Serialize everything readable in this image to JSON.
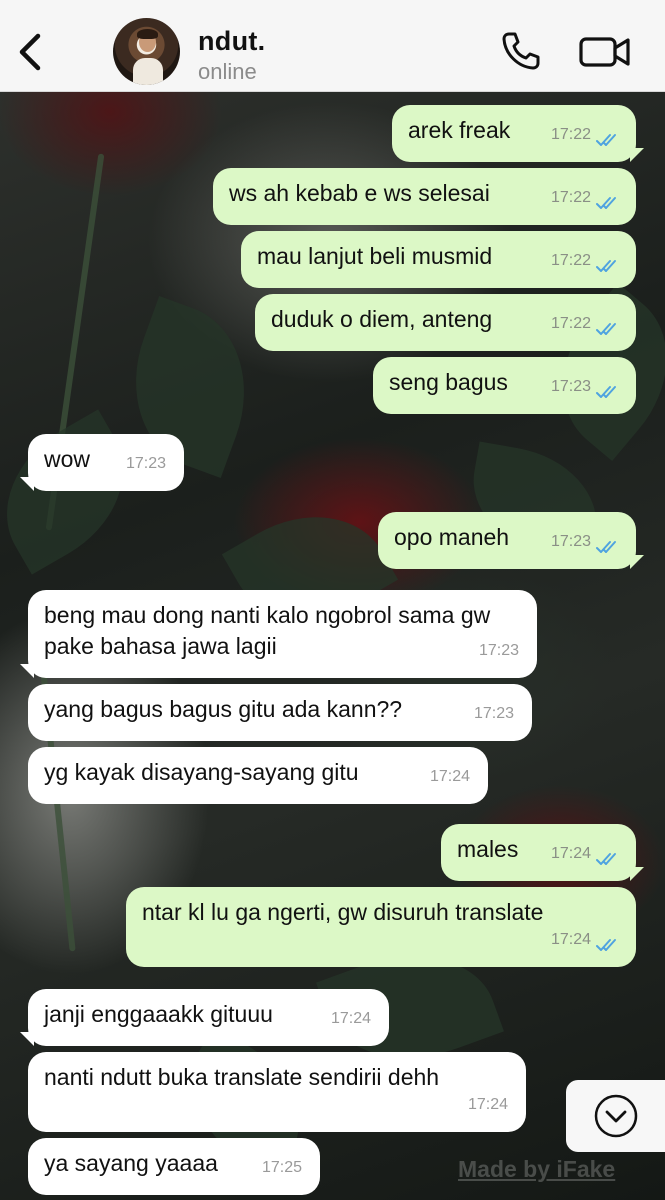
{
  "header": {
    "contact_name": "ndut.",
    "status": "online"
  },
  "colors": {
    "outgoing_bubble": "#dcf8c6",
    "incoming_bubble": "#ffffff",
    "read_ticks": "#4fa3e0"
  },
  "messages": [
    {
      "dir": "out",
      "text": "arek freak",
      "time": "17:22",
      "read": true
    },
    {
      "dir": "out",
      "text": "ws ah kebab e ws selesai",
      "time": "17:22",
      "read": true
    },
    {
      "dir": "out",
      "text": "mau lanjut beli musmid",
      "time": "17:22",
      "read": true
    },
    {
      "dir": "out",
      "text": "duduk o diem, anteng",
      "time": "17:22",
      "read": true
    },
    {
      "dir": "out",
      "text": "seng bagus",
      "time": "17:23",
      "read": true
    },
    {
      "dir": "in",
      "text": "wow",
      "time": "17:23"
    },
    {
      "dir": "out",
      "text": "opo maneh",
      "time": "17:23",
      "read": true
    },
    {
      "dir": "in",
      "text": "beng mau dong nanti kalo ngobrol sama gw pake bahasa jawa lagii",
      "time": "17:23"
    },
    {
      "dir": "in",
      "text": "yang bagus bagus gitu ada kann??",
      "time": "17:23"
    },
    {
      "dir": "in",
      "text": "yg kayak disayang-sayang gitu",
      "time": "17:24"
    },
    {
      "dir": "out",
      "text": "males",
      "time": "17:24",
      "read": true
    },
    {
      "dir": "out",
      "text": "ntar kl lu ga ngerti, gw disuruh translate",
      "time": "17:24",
      "read": true
    },
    {
      "dir": "in",
      "text": "janji enggaaakk gituuu",
      "time": "17:24"
    },
    {
      "dir": "in",
      "text": "nanti ndutt buka translate sendirii dehh",
      "time": "17:24"
    },
    {
      "dir": "in",
      "text": "ya sayang yaaaa",
      "time": "17:25"
    }
  ],
  "watermark": "Made by iFake"
}
